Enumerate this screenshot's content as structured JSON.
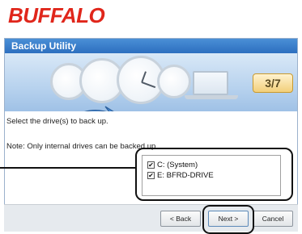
{
  "brand": {
    "logo_text": "BUFFALO",
    "color": "#e0261b"
  },
  "window": {
    "title": "Backup Utility"
  },
  "step": {
    "current": "3",
    "total": "7",
    "label": "3/7"
  },
  "content": {
    "instruction": "Select the drive(s) to back up.",
    "note": "Note: Only internal drives can be backed up.",
    "drives": [
      {
        "label": "C: (System)",
        "checked": true
      },
      {
        "label": "E: BFRD-DRIVE",
        "checked": true
      }
    ]
  },
  "buttons": {
    "back": "< Back",
    "next": "Next >",
    "cancel": "Cancel"
  },
  "icons": {
    "clocks": "clock-icon",
    "laptop": "laptop-icon",
    "arrow": "backup-arrow-icon"
  }
}
